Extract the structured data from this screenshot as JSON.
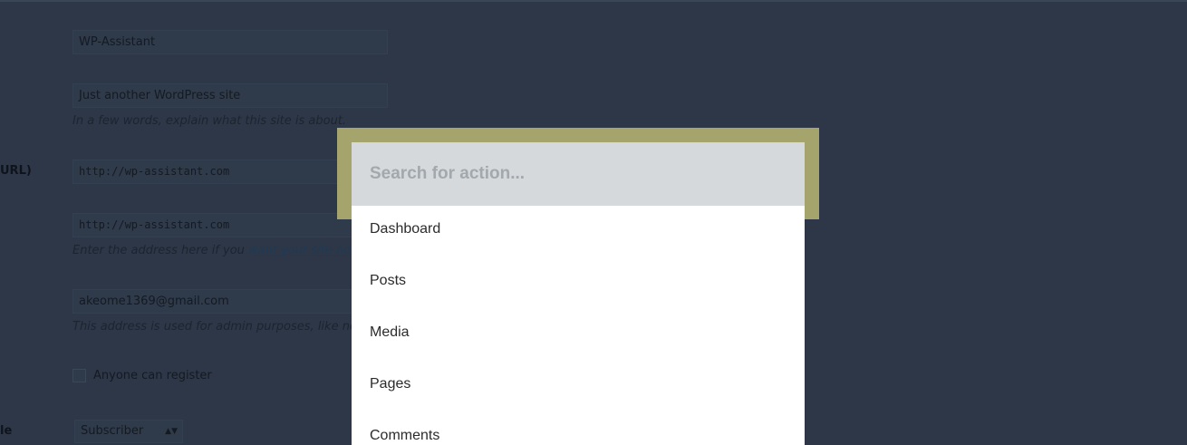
{
  "settings_form": {
    "labels": {
      "site_address": "URL)",
      "default_role": "le"
    },
    "site_title": "WP-Assistant",
    "tagline": "Just another WordPress site",
    "tagline_desc": "In a few words, explain what this site is about.",
    "wordpress_address": "http://wp-assistant.com",
    "site_address": "http://wp-assistant.com",
    "site_address_desc_prefix": "Enter the address here if you ",
    "site_address_desc_link": "want your site home",
    "admin_email": "akeome1369@gmail.com",
    "admin_email_desc": "This address is used for admin purposes, like new",
    "membership_label": "Anyone can register",
    "default_role": "Subscriber"
  },
  "palette": {
    "search_placeholder": "Search for action...",
    "search_value": "",
    "items": [
      {
        "label": "Dashboard"
      },
      {
        "label": "Posts"
      },
      {
        "label": "Media"
      },
      {
        "label": "Pages"
      },
      {
        "label": "Comments"
      }
    ]
  },
  "colors": {
    "overlay_bg": "#2d3747",
    "palette_frame": "#a4a46c",
    "search_bg": "#d5d9db",
    "list_bg": "#ffffff"
  }
}
